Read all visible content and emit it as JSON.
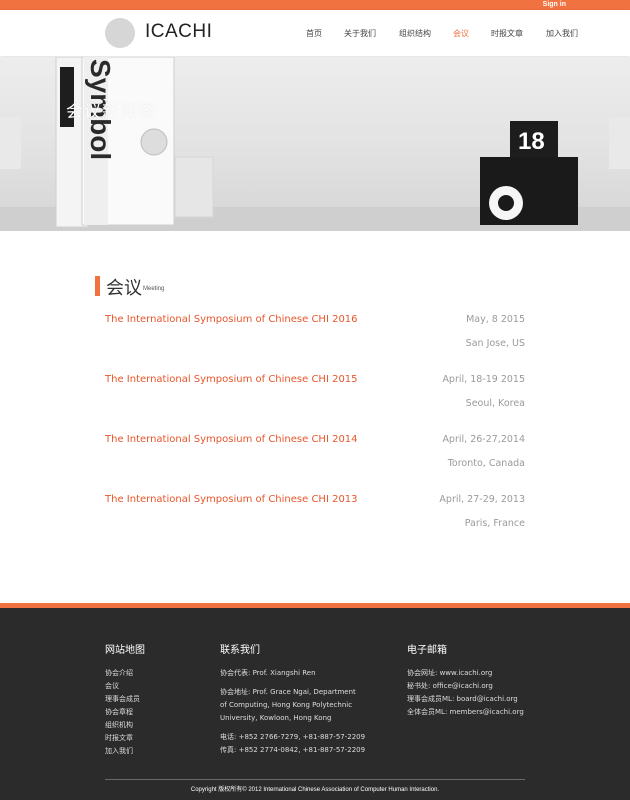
{
  "topbar": {
    "signin_label": "Sign in",
    "accent_color": "#f07241"
  },
  "header": {
    "logo_text": "ICACHI",
    "nav": [
      {
        "label": "首页"
      },
      {
        "label": "关于我们"
      },
      {
        "label": "组织结构"
      },
      {
        "label": "会议",
        "active": true
      },
      {
        "label": "时报文章"
      },
      {
        "label": "加入我们"
      }
    ]
  },
  "hero": {
    "title": "会议新闻图",
    "photo_book_text": "Symbol",
    "photo_sign_number": "18",
    "prev_icon": "chevron-left-icon",
    "next_icon": "chevron-right-icon"
  },
  "section": {
    "title_cn": "会议",
    "title_en": "Meeting",
    "meetings": [
      {
        "name": "The International Symposium of Chinese CHI 2016",
        "date": "May, 8 2015",
        "place": "San Jose, US"
      },
      {
        "name": "The International Symposium of Chinese CHI 2015",
        "date": "April, 18-19 2015",
        "place": "Seoul, Korea"
      },
      {
        "name": "The International Symposium of Chinese CHI 2014",
        "date": "April, 26-27,2014",
        "place": "Toronto, Canada"
      },
      {
        "name": "The International Symposium of Chinese CHI 2013",
        "date": "April, 27-29, 2013",
        "place": "Paris, France"
      }
    ]
  },
  "footer": {
    "sitemap": {
      "title": "网站地图",
      "links": [
        "协会介绍",
        "会议",
        "理事会成员",
        "协会章程",
        "组织机构",
        "时报文章",
        "加入我们"
      ]
    },
    "contact": {
      "title": "联系我们",
      "representative": "协会代表: Prof. Xiangshi Ren",
      "address_lines": [
        "协会地址: Prof. Grace Ngai, Department",
        "of Computing, Hong Kong Polytechnic",
        "University, Kowloon, Hong Kong"
      ],
      "phone": "电话: +852 2766-7279, +81-887-57-2209",
      "fax": "传真: +852 2774-0842, +81-887-57-2209"
    },
    "email": {
      "title": "电子邮箱",
      "lines": [
        "协会网址: www.icachi.org",
        "秘书处: office@icachi.org",
        "理事会成员ML: board@icachi.org",
        "全体会员ML: members@icachi.org"
      ]
    },
    "copyright": "Copyright 版权所有© 2012 International Chinese Association of Computer Human Interaction."
  }
}
